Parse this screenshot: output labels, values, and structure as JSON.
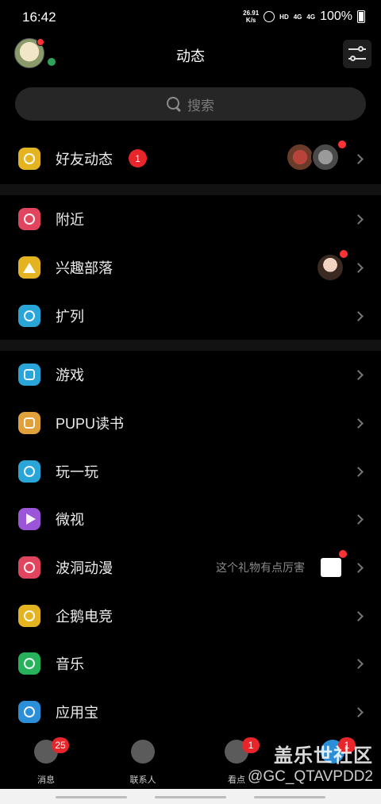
{
  "status_bar": {
    "time": "16:42",
    "speed_value": "26.91",
    "speed_unit": "K/s",
    "hd": "HD",
    "sig1": "4G",
    "sig2": "4G",
    "battery": "100%"
  },
  "header": {
    "title": "动态"
  },
  "search": {
    "placeholder": "搜索"
  },
  "list": {
    "friends": {
      "label": "好友动态",
      "badge": "1",
      "icon_color": "#e3b320"
    },
    "nearby": {
      "label": "附近",
      "icon_color": "#e0445e"
    },
    "tribe": {
      "label": "兴趣部落",
      "icon_color": "#e3b320"
    },
    "kuolie": {
      "label": "扩列",
      "icon_color": "#2aa5d8"
    },
    "games": {
      "label": "游戏",
      "icon_color": "#2aa5d8"
    },
    "pupu": {
      "label": "PUPU读书",
      "icon_color": "#e0a03a"
    },
    "play": {
      "label": "玩一玩",
      "icon_color": "#2aa5d8"
    },
    "weishi": {
      "label": "微视",
      "icon_color": "#9b55d8"
    },
    "bodong": {
      "label": "波洞动漫",
      "hint": "这个礼物有点厉害",
      "icon_color": "#e0445e"
    },
    "esports": {
      "label": "企鹅电竞",
      "icon_color": "#e3b320"
    },
    "music": {
      "label": "音乐",
      "icon_color": "#27b15a"
    },
    "appstore": {
      "label": "应用宝",
      "icon_color": "#2a8fd8"
    }
  },
  "nav": {
    "messages": {
      "label": "消息",
      "badge": "25"
    },
    "contacts": {
      "label": "联系人"
    },
    "watch": {
      "label": "看点",
      "badge": "1"
    },
    "dynamic": {
      "badge": "1"
    }
  },
  "watermark": {
    "line1": "盖乐世社区",
    "line2": "@GC_QTAVPDD2"
  }
}
